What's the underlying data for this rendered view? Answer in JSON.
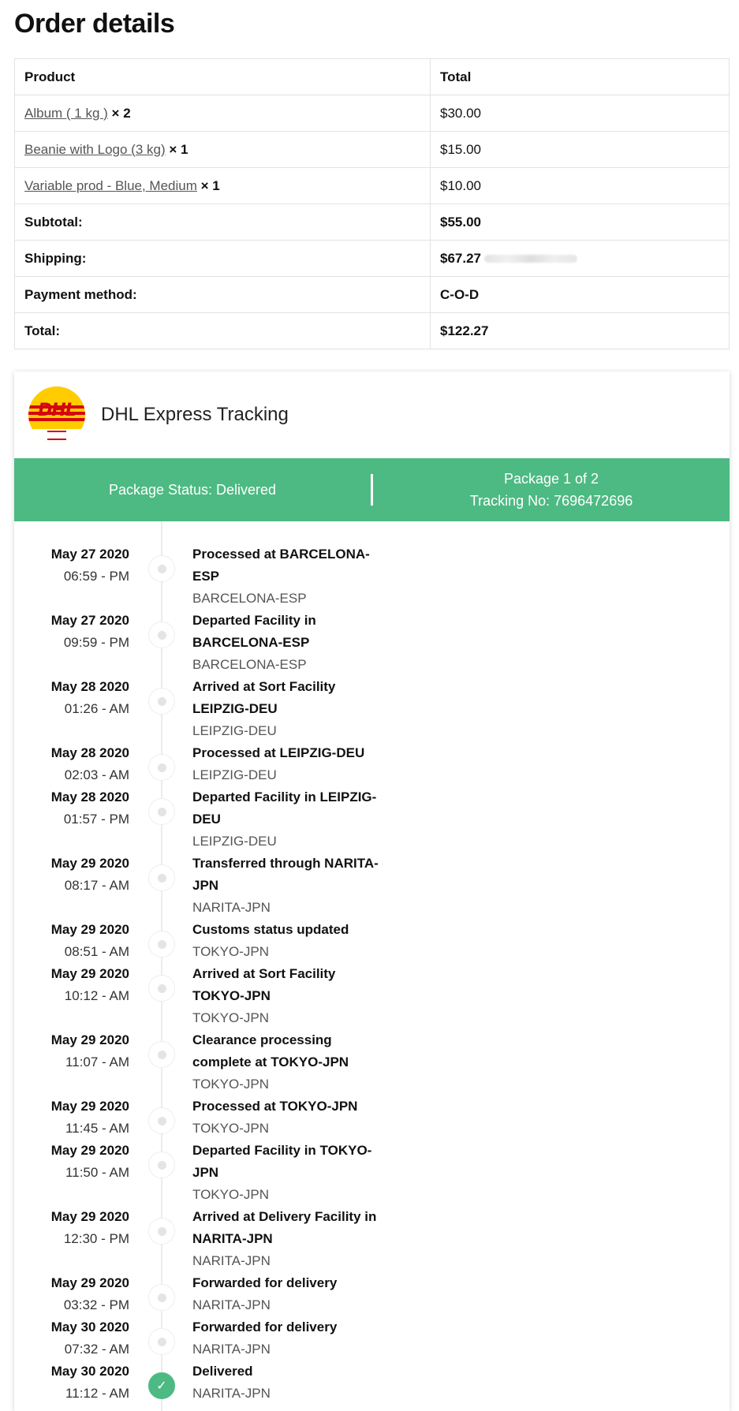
{
  "page_title": "Order details",
  "table": {
    "head_product": "Product",
    "head_total": "Total",
    "items": [
      {
        "name": "Album ( 1 kg )",
        "qty": "× 2",
        "total": "$30.00"
      },
      {
        "name": "Beanie with Logo (3 kg)",
        "qty": "× 1",
        "total": "$15.00"
      },
      {
        "name": "Variable prod - Blue, Medium",
        "qty": "× 1",
        "total": "$10.00"
      }
    ],
    "subtotal_label": "Subtotal:",
    "subtotal_value": "$55.00",
    "shipping_label": "Shipping:",
    "shipping_value": "$67.27",
    "payment_label": "Payment method:",
    "payment_value": "C-O-D",
    "total_label": "Total:",
    "total_value": "$122.27"
  },
  "tracking": {
    "logo_text": "DHL",
    "title": "DHL Express Tracking",
    "status": "Package Status: Delivered",
    "package_count": "Package 1 of 2",
    "tracking_no": "Tracking No: 7696472696",
    "events": [
      {
        "date": "May 27 2020",
        "time": "06:59 - PM",
        "desc": "Processed at BARCELONA-ESP",
        "loc": "BARCELONA-ESP"
      },
      {
        "date": "May 27 2020",
        "time": "09:59 - PM",
        "desc": "Departed Facility in BARCELONA-ESP",
        "loc": "BARCELONA-ESP"
      },
      {
        "date": "May 28 2020",
        "time": "01:26 - AM",
        "desc": "Arrived at Sort Facility LEIPZIG-DEU",
        "loc": "LEIPZIG-DEU"
      },
      {
        "date": "May 28 2020",
        "time": "02:03 - AM",
        "desc": "Processed at LEIPZIG-DEU",
        "loc": "LEIPZIG-DEU"
      },
      {
        "date": "May 28 2020",
        "time": "01:57 - PM",
        "desc": "Departed Facility in LEIPZIG-DEU",
        "loc": "LEIPZIG-DEU"
      },
      {
        "date": "May 29 2020",
        "time": "08:17 - AM",
        "desc": "Transferred through NARITA-JPN",
        "loc": "NARITA-JPN"
      },
      {
        "date": "May 29 2020",
        "time": "08:51 - AM",
        "desc": "Customs status updated",
        "loc": "TOKYO-JPN"
      },
      {
        "date": "May 29 2020",
        "time": "10:12 - AM",
        "desc": "Arrived at Sort Facility TOKYO-JPN",
        "loc": "TOKYO-JPN"
      },
      {
        "date": "May 29 2020",
        "time": "11:07 - AM",
        "desc": "Clearance processing complete at TOKYO-JPN",
        "loc": "TOKYO-JPN"
      },
      {
        "date": "May 29 2020",
        "time": "11:45 - AM",
        "desc": "Processed at TOKYO-JPN",
        "loc": "TOKYO-JPN"
      },
      {
        "date": "May 29 2020",
        "time": "11:50 - AM",
        "desc": "Departed Facility in TOKYO-JPN",
        "loc": "TOKYO-JPN"
      },
      {
        "date": "May 29 2020",
        "time": "12:30 - PM",
        "desc": "Arrived at Delivery Facility in NARITA-JPN",
        "loc": "NARITA-JPN"
      },
      {
        "date": "May 29 2020",
        "time": "03:32 - PM",
        "desc": "Forwarded for delivery",
        "loc": "NARITA-JPN"
      },
      {
        "date": "May 30 2020",
        "time": "07:32 - AM",
        "desc": "Forwarded for delivery",
        "loc": "NARITA-JPN"
      },
      {
        "date": "May 30 2020",
        "time": "11:12 - AM",
        "desc": "Delivered",
        "loc": "NARITA-JPN",
        "done": true
      }
    ]
  },
  "colors": {
    "accent_green": "#4cba82",
    "dhl_yellow": "#ffcc00",
    "dhl_red": "#d40511"
  },
  "icons": {
    "delivered": "check-icon",
    "pending": "dot-icon"
  }
}
